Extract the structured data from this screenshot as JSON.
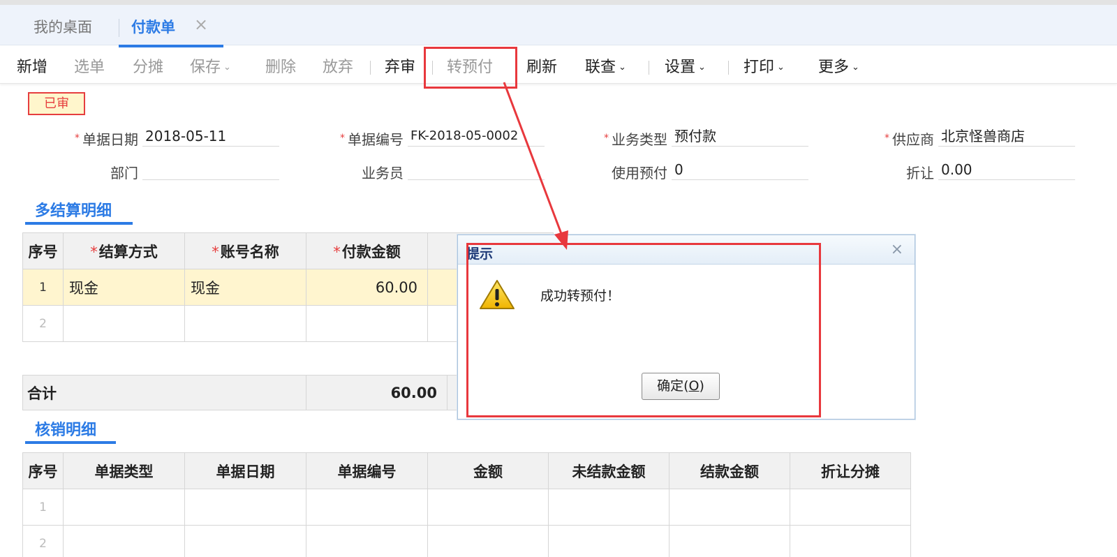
{
  "tabs": {
    "home": "我的桌面",
    "active": "付款单",
    "close": "×"
  },
  "toolbar": {
    "add": "新增",
    "select": "选单",
    "allocate": "分摊",
    "save": "保存",
    "delete": "删除",
    "abandon": "放弃",
    "unaudit": "弃审",
    "to_prepay": "转预付",
    "refresh": "刷新",
    "linked_query": "联查",
    "settings": "设置",
    "print": "打印",
    "more": "更多",
    "caret": "⌄"
  },
  "status_badge": "已审",
  "form": {
    "doc_date_label": "单据日期",
    "doc_date": "2018-05-11",
    "doc_no_label": "单据编号",
    "doc_no": "FK-2018-05-0002",
    "biz_type_label": "业务类型",
    "biz_type": "预付款",
    "supplier_label": "供应商",
    "supplier": "北京怪兽商店",
    "dept_label": "部门",
    "dept": "",
    "clerk_label": "业务员",
    "clerk": "",
    "use_prepay_label": "使用预付",
    "use_prepay": "0",
    "discount_label": "折让",
    "discount": "0.00",
    "required_mark": "*"
  },
  "settlement": {
    "title": "多结算明细",
    "headers": [
      "序号",
      "结算方式",
      "账号名称",
      "付款金额"
    ],
    "rows": [
      {
        "idx": "1",
        "method": "现金",
        "account": "现金",
        "amount": "60.00"
      },
      {
        "idx": "2",
        "method": "",
        "account": "",
        "amount": ""
      }
    ],
    "total_label": "合计",
    "total_amount": "60.00"
  },
  "writeoff": {
    "title": "核销明细",
    "headers": [
      "序号",
      "单据类型",
      "单据日期",
      "单据编号",
      "金额",
      "未结款金额",
      "结款金额",
      "折让分摊"
    ],
    "rows": [
      {
        "idx": "1"
      },
      {
        "idx": "2"
      }
    ]
  },
  "dialog": {
    "title": "提示",
    "close": "×",
    "message": "成功转预付！",
    "ok_label": "确定(",
    "ok_key": "O",
    "ok_close": ")"
  },
  "colors": {
    "accent": "#2c7be5",
    "highlight": "#e8383d",
    "selected_row": "#fff5cf"
  }
}
